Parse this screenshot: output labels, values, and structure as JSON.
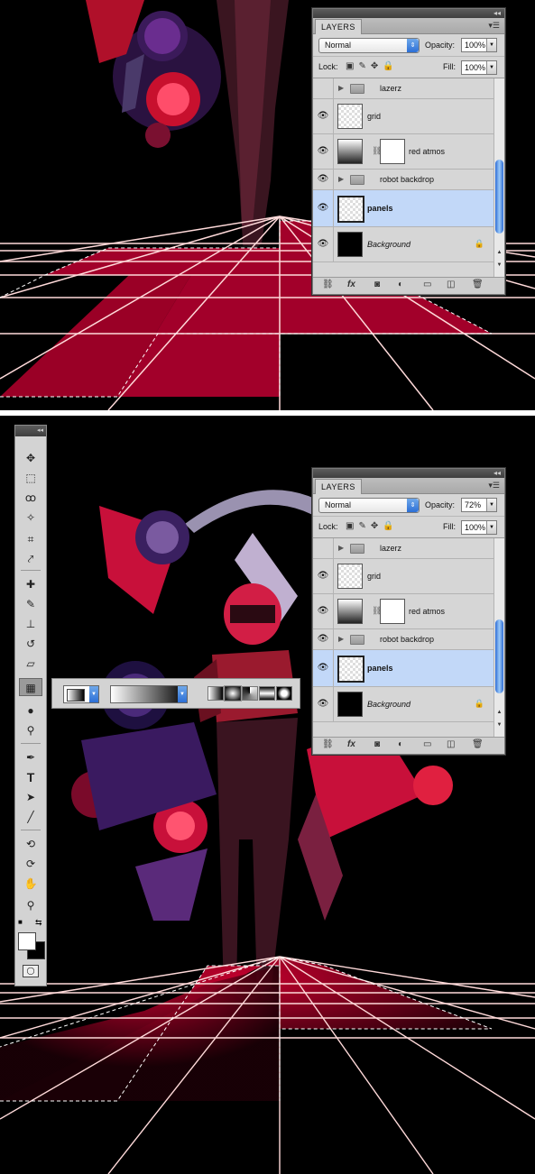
{
  "panel_top": {
    "tab": "LAYERS",
    "blend_mode": "Normal",
    "opacity_label": "Opacity:",
    "opacity": "100%",
    "lock_label": "Lock:",
    "fill_label": "Fill:",
    "fill": "100%",
    "layers": [
      {
        "name": "lazerz",
        "type": "group",
        "visible": false
      },
      {
        "name": "grid",
        "type": "layer",
        "visible": true
      },
      {
        "name": "red atmos",
        "type": "adjustment",
        "visible": true
      },
      {
        "name": "robot backdrop",
        "type": "group",
        "visible": true
      },
      {
        "name": "panels",
        "type": "layer",
        "visible": true,
        "selected": true
      },
      {
        "name": "Background",
        "type": "background",
        "visible": true
      }
    ]
  },
  "panel_bottom": {
    "tab": "LAYERS",
    "blend_mode": "Normal",
    "opacity_label": "Opacity:",
    "opacity": "72%",
    "lock_label": "Lock:",
    "fill_label": "Fill:",
    "fill": "100%",
    "layers": [
      {
        "name": "lazerz",
        "type": "group",
        "visible": false
      },
      {
        "name": "grid",
        "type": "layer",
        "visible": true
      },
      {
        "name": "red atmos",
        "type": "adjustment",
        "visible": true
      },
      {
        "name": "robot backdrop",
        "type": "group",
        "visible": true
      },
      {
        "name": "panels",
        "type": "layer",
        "visible": true,
        "selected": true
      },
      {
        "name": "Background",
        "type": "background",
        "visible": true
      }
    ]
  },
  "tools": [
    "move-tool",
    "marquee-tool",
    "lasso-tool",
    "magic-wand-tool",
    "crop-tool",
    "eyedropper-tool",
    "healing-brush-tool",
    "brush-tool",
    "clone-stamp-tool",
    "history-brush-tool",
    "eraser-tool",
    "gradient-tool",
    "blur-tool",
    "dodge-tool",
    "pen-tool",
    "type-tool",
    "path-selection-tool",
    "line-tool",
    "3d-rotate-tool",
    "3d-orbit-tool",
    "hand-tool",
    "zoom-tool"
  ],
  "type_tool_glyph": "T",
  "options_bar": {
    "gradient_types": [
      "linear",
      "radial",
      "angle",
      "reflected",
      "diamond"
    ],
    "active_type": "radial"
  },
  "colors": {
    "panel_bg": "#d6d6d6",
    "selected_row": "#c2d8f8",
    "scrollbar": "#2d6bd4",
    "floor_red": "#a0002a",
    "grid_line": "#ffd6d6"
  }
}
